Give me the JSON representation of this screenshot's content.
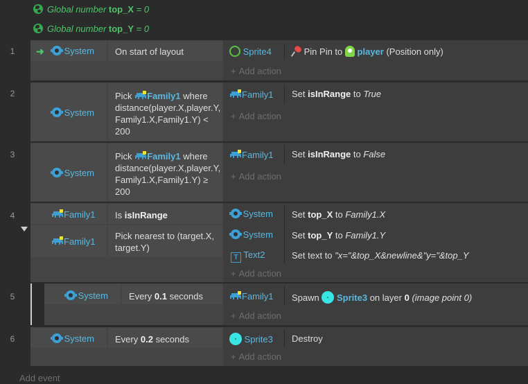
{
  "globals": [
    {
      "prefix": "Global number",
      "name": "top_X",
      "suffix": "= 0"
    },
    {
      "prefix": "Global number",
      "name": "top_Y",
      "suffix": "= 0"
    }
  ],
  "events": [
    {
      "number": "1",
      "conditions": [
        {
          "object": "System",
          "icon": "gear-icon",
          "text": "On start of layout",
          "trigger": true
        }
      ],
      "actions": [
        {
          "object": "Sprite4",
          "icon": "sprite-outline-icon",
          "parts": [
            "Pin Pin to",
            "player",
            "(Position only)"
          ]
        }
      ]
    },
    {
      "number": "2",
      "conditions": [
        {
          "object": "System",
          "icon": "gear-icon",
          "text_pre": "Pick",
          "text_obj": "Family1",
          "text_post": "where distance(player.X,player.Y, Family1.X,Family1.Y) < 200"
        }
      ],
      "actions": [
        {
          "object": "Family1",
          "icon": "family-icon",
          "pre": "Set",
          "bold": "isInRange",
          "mid": "to",
          "italic": "True"
        }
      ]
    },
    {
      "number": "3",
      "conditions": [
        {
          "object": "System",
          "icon": "gear-icon",
          "text_pre": "Pick",
          "text_obj": "Family1",
          "text_post": "where distance(player.X,player.Y, Family1.X,Family1.Y) ≥ 200"
        }
      ],
      "actions": [
        {
          "object": "Family1",
          "icon": "family-icon",
          "pre": "Set",
          "bold": "isInRange",
          "mid": "to",
          "italic": "False"
        }
      ]
    },
    {
      "number": "4",
      "conditions": [
        {
          "object": "Family1",
          "icon": "family-icon",
          "pre": "Is",
          "bold": "isInRange"
        },
        {
          "object": "Family1",
          "icon": "family-icon",
          "text": "Pick nearest to (target.X, target.Y)"
        }
      ],
      "actions": [
        {
          "object": "System",
          "icon": "gear-icon",
          "pre": "Set",
          "bold": "top_X",
          "mid": "to",
          "italic": "Family1.X"
        },
        {
          "object": "System",
          "icon": "gear-icon",
          "pre": "Set",
          "bold": "top_Y",
          "mid": "to",
          "italic": "Family1.Y"
        },
        {
          "object": "Text2",
          "icon": "text-icon",
          "pre": "Set text to",
          "italic": "\"x=\"&top_X&newline&\"y=\"&top_Y"
        }
      ]
    },
    {
      "number": "5",
      "conditions": [
        {
          "object": "System",
          "icon": "gear-icon",
          "pre": "Every",
          "bold": "0.1",
          "post": "seconds"
        }
      ],
      "actions": [
        {
          "object": "Family1",
          "icon": "family-icon",
          "pre": "Spawn",
          "obj": "Sprite3",
          "mid": "on layer",
          "bold": "0",
          "italic": "(image point 0)"
        }
      ]
    },
    {
      "number": "6",
      "conditions": [
        {
          "object": "System",
          "icon": "gear-icon",
          "pre": "Every",
          "bold": "0.2",
          "post": "seconds"
        }
      ],
      "actions": [
        {
          "object": "Sprite3",
          "icon": "sprite-cyan-icon",
          "text": "Destroy"
        }
      ]
    }
  ],
  "add_action_label": "Add action",
  "add_action_symbol": "+",
  "add_event_label": "Add event",
  "colors": {
    "accent": "#3e9fd4",
    "global": "#4fc46a",
    "sprite": "#38e4e4"
  }
}
